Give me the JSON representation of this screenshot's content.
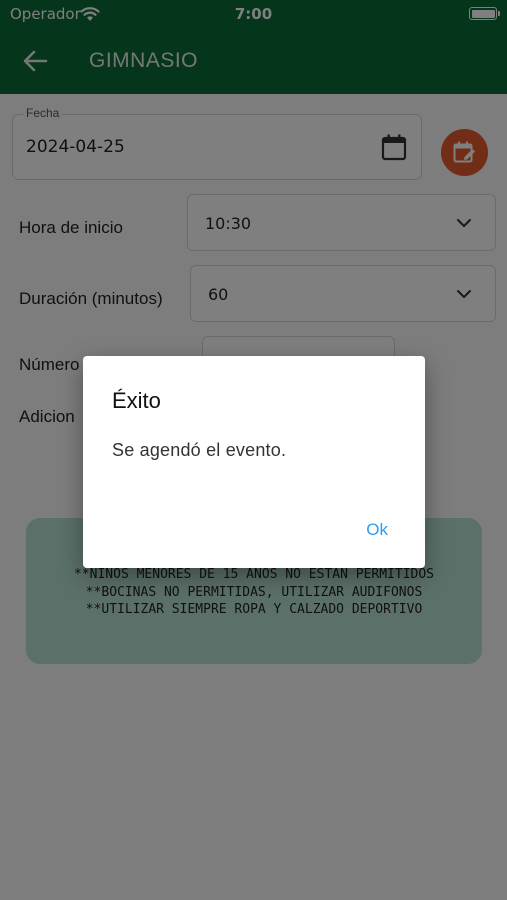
{
  "status_bar": {
    "carrier": "Operador",
    "time": "7:00",
    "wifi_icon": "wifi-icon",
    "battery_icon": "battery-icon"
  },
  "app_bar": {
    "back_icon": "arrow-left-icon",
    "title": "GIMNASIO",
    "background": "#0b6b34"
  },
  "form": {
    "date_label": "Fecha",
    "date_value": "2024-04-25",
    "calendar_icon": "calendar-icon",
    "schedule_button_icon": "calendar-edit-icon",
    "schedule_button_color": "#e35b2a",
    "start_time_label": "Hora de inicio",
    "start_time_value": "10:30",
    "duration_label": "Duración (minutos)",
    "duration_value": "60",
    "number_label": "Número",
    "additional_label": "Adicion"
  },
  "notice": {
    "background": "#b6e0d3",
    "lines": [
      "**NIÑOS MENORES DE 15 AÑOS NO ESTAN PERMITIDOS",
      "**BOCINAS NO PERMITIDAS, UTILIZAR AUDIFONOS",
      "**UTILIZAR SIEMPRE ROPA Y CALZADO DEPORTIVO"
    ]
  },
  "dialog": {
    "title": "Éxito",
    "message": "Se agendó el evento.",
    "ok_label": "Ok",
    "ok_color": "#2a9df4"
  }
}
